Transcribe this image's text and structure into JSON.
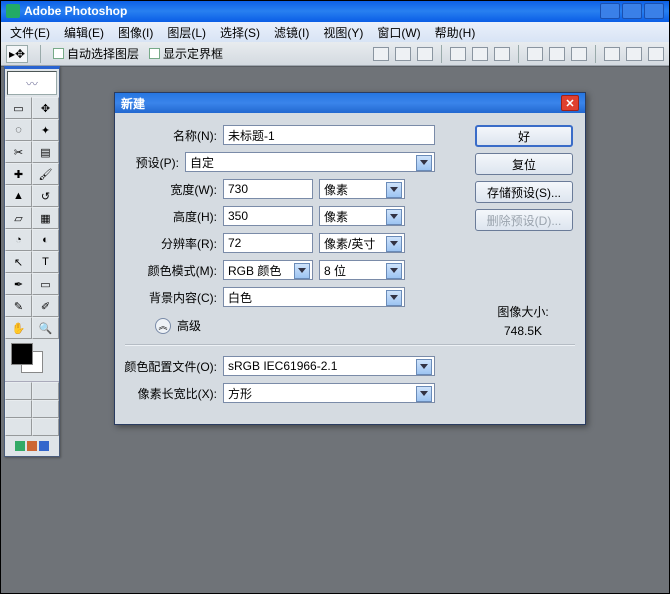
{
  "app": {
    "title": "Adobe Photoshop"
  },
  "menu": {
    "file": "文件(E)",
    "edit": "编辑(E)",
    "image": "图像(I)",
    "layer": "图层(L)",
    "select": "选择(S)",
    "filter": "滤镜(I)",
    "view": "视图(Y)",
    "window": "窗口(W)",
    "help": "帮助(H)"
  },
  "options": {
    "autoSelectLayer": "自动选择图层",
    "showBounds": "显示定界框"
  },
  "dialog": {
    "title": "新建",
    "labels": {
      "name": "名称(N):",
      "preset": "预设(P):",
      "width": "宽度(W):",
      "height": "高度(H):",
      "resolution": "分辨率(R):",
      "colorMode": "颜色模式(M):",
      "background": "背景内容(C):",
      "advanced": "高级",
      "colorProfile": "颜色配置文件(O):",
      "pixelAspect": "像素长宽比(X):",
      "imageSizeLabel": "图像大小:"
    },
    "values": {
      "name": "未标题-1",
      "preset": "自定",
      "width": "730",
      "widthUnit": "像素",
      "height": "350",
      "heightUnit": "像素",
      "resolution": "72",
      "resolutionUnit": "像素/英寸",
      "colorMode": "RGB 颜色",
      "bitDepth": "8 位",
      "background": "白色",
      "colorProfile": "sRGB IEC61966-2.1",
      "pixelAspect": "方形",
      "imageSize": "748.5K"
    },
    "buttons": {
      "ok": "好",
      "reset": "复位",
      "savePreset": "存储预设(S)...",
      "deletePreset": "删除预设(D)..."
    }
  }
}
